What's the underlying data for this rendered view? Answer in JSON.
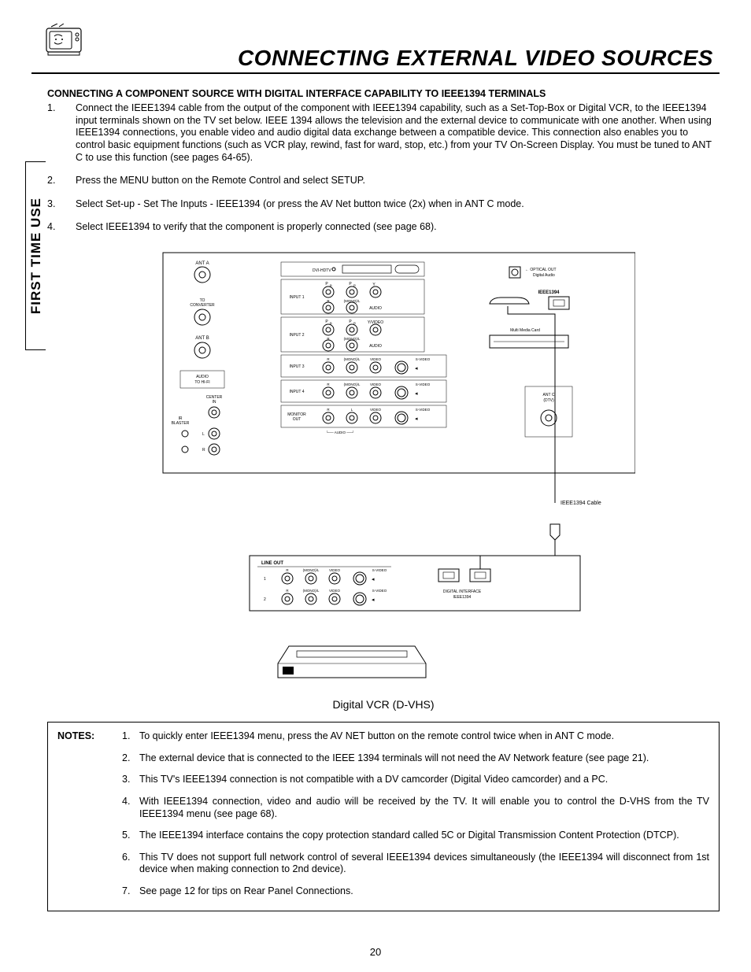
{
  "sidebar": {
    "label": "FIRST TIME USE"
  },
  "title": "CONNECTING EXTERNAL VIDEO SOURCES",
  "section_heading": "CONNECTING A COMPONENT SOURCE WITH DIGITAL INTERFACE CAPABILITY TO IEEE1394 TERMINALS",
  "steps": [
    "Connect the IEEE1394 cable from the output of the component with IEEE1394 capability, such as a Set-Top-Box or Digital VCR, to the IEEE1394 input terminals shown on the TV set below.  IEEE 1394 allows the television and the external device to communicate with one another.  When using IEEE1394 connections, you enable video and audio digital data exchange between a compatible device.  This connection also enables you to control basic equipment functions (such as VCR play, rewind, fast for ward, stop, etc.) from your TV On-Screen Display.  You must be tuned to ANT C to use this function (see pages 64-65).",
    "Press the MENU button on the Remote Control and select SETUP.",
    "Select Set-up - Set The Inputs - IEEE1394 (or press the AV Net button twice (2x) when in ANT C mode.",
    "Select IEEE1394 to verify that the component is properly connected (see page 68)."
  ],
  "diagram": {
    "tv_panel": {
      "ant_a": "ANT A",
      "to_converter": "TO\nCONVERTER",
      "ant_b": "ANT B",
      "audio_to_hifi": "AUDIO\nTO HI-FI",
      "center_in": "CENTER\nIN",
      "ir_blaster": "IR\nBLASTER",
      "left_ch": "L",
      "right_ch": "R",
      "dvi_hdtv": "DVI-HDTV",
      "input1": "INPUT 1",
      "input2": "INPUT 2",
      "input3": "INPUT 3",
      "input4": "INPUT 4",
      "monitor_out": "MONITOR\nOUT",
      "pb": "PB",
      "pr": "PR",
      "y": "Y",
      "yvideo": "Y/VIDEO",
      "r": "R",
      "mono_l": "(MONO)/L",
      "l": "L",
      "audio": "AUDIO",
      "video": "VIDEO",
      "svideo": "S-VIDEO",
      "audio_caption": "AUDIO",
      "optical_out": "OPTICAL OUT\nDigital Audio",
      "ieee1394": "IEEE1394",
      "mmc": "Multi Media Card",
      "ant_c": "ANT C\n(DTV)"
    },
    "cable_label": "IEEE1394 Cable",
    "device_panel": {
      "line_out": "LINE OUT",
      "row1": "1",
      "row2": "2",
      "r": "R",
      "mono_l": "(MONO)/L",
      "video": "VIDEO",
      "svideo": "S-VIDEO",
      "digital_iface": "DIGITAL INTERFACE\nIEEE1394"
    },
    "vcr_label": "Digital VCR (D-VHS)"
  },
  "notes_label": "NOTES:",
  "notes": [
    "To quickly enter IEEE1394 menu, press the AV NET button on the remote control twice when in ANT C mode.",
    "The external device that is connected to the IEEE 1394 terminals will not need the AV Network feature (see page 21).",
    "This TV's IEEE1394 connection is not compatible with a DV camcorder (Digital Video camcorder) and a PC.",
    "With IEEE1394 connection, video and audio will be received by the TV.  It will enable you to control the D-VHS from the TV IEEE1394 menu (see page 68).",
    "The IEEE1394 interface contains the copy protection standard called 5C or Digital Transmission Content Protection (DTCP).",
    "This TV does not support full network control of several IEEE1394 devices simultaneously (the IEEE1394 will disconnect from 1st device when making connection to 2nd device).",
    "See page 12 for tips on Rear Panel Connections."
  ],
  "page_number": "20"
}
